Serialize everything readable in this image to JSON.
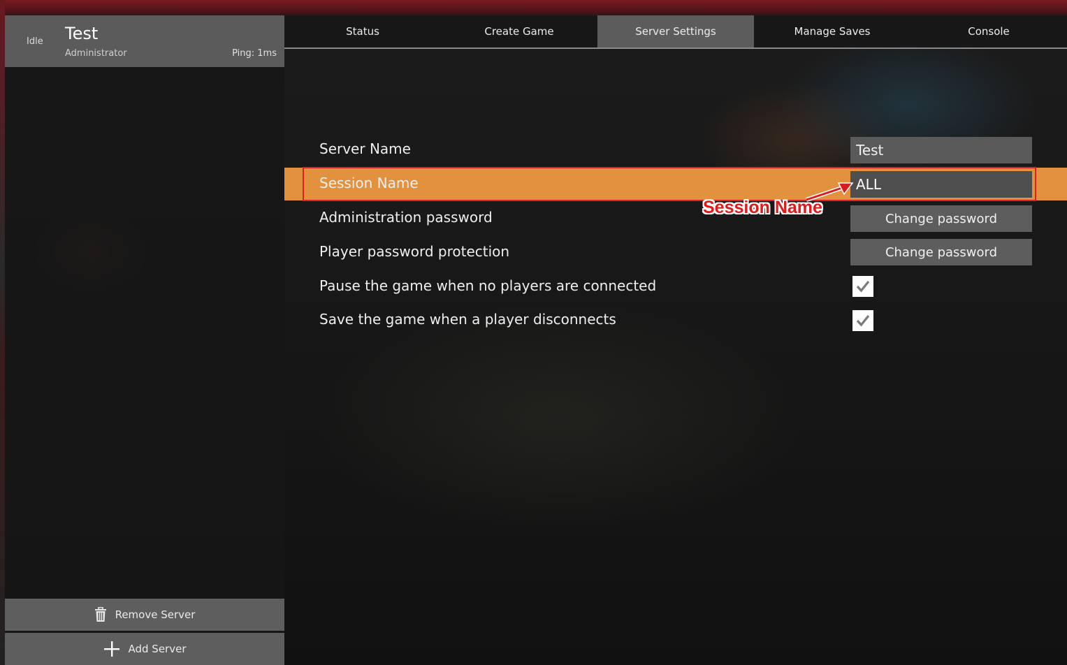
{
  "server": {
    "status": "Idle",
    "name": "Test",
    "role": "Administrator",
    "ping": "Ping: 1ms"
  },
  "sidebar": {
    "remove_label": "Remove Server",
    "add_label": "Add Server"
  },
  "tabs": [
    {
      "label": "Status"
    },
    {
      "label": "Create Game"
    },
    {
      "label": "Server Settings"
    },
    {
      "label": "Manage Saves"
    },
    {
      "label": "Console"
    }
  ],
  "active_tab": "Server Settings",
  "settings": {
    "server_name_label": "Server Name",
    "server_name_value": "Test",
    "session_name_label": "Session Name",
    "session_name_value": "ALL",
    "admin_password_label": "Administration password",
    "admin_password_button": "Change password",
    "player_password_label": "Player password protection",
    "player_password_button": "Change password",
    "pause_label": "Pause the game when no players are connected",
    "pause_checked": true,
    "save_label": "Save the game when a player disconnects",
    "save_checked": true
  },
  "annotation": {
    "text": "Session Name",
    "color": "#e01a1a"
  },
  "colors": {
    "highlight": "#e2913f",
    "active_tab": "#5c5c5c"
  },
  "icons": {
    "remove": "trash-icon",
    "add": "plus-icon",
    "check": "checkmark-icon"
  }
}
